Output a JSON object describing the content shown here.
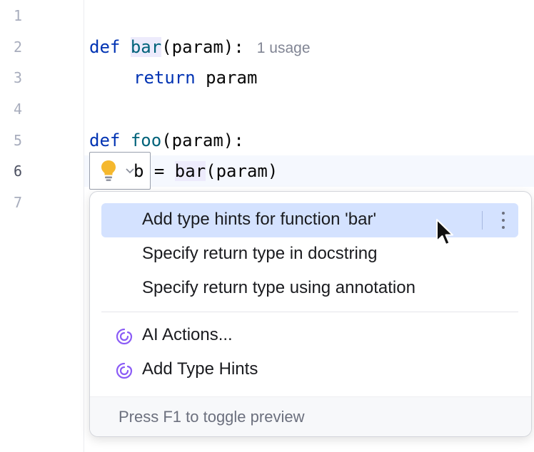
{
  "gutter": {
    "line_numbers": [
      "1",
      "2",
      "3",
      "4",
      "5",
      "6",
      "7"
    ],
    "current_line": "6"
  },
  "code": {
    "line2": {
      "kw": "def",
      "name": "bar",
      "rest": "(param):",
      "inlay_hint": "1 usage"
    },
    "line3": {
      "kw": "return",
      "rest": "param"
    },
    "line5": {
      "kw": "def",
      "name": "foo",
      "rest": "(param):"
    },
    "line6": {
      "lhs": "b = ",
      "call": "bar",
      "rest": "(param)"
    }
  },
  "intention_popup": {
    "items": [
      {
        "label": "Add type hints for function 'bar'",
        "selected": true
      },
      {
        "label": "Specify return type in docstring"
      },
      {
        "label": "Specify return type using annotation"
      }
    ],
    "ai_items": [
      {
        "label": "AI Actions...",
        "icon": "ai-spiral-icon"
      },
      {
        "label": "Add Type Hints",
        "icon": "ai-spiral-icon"
      }
    ],
    "footer": "Press F1 to toggle preview"
  },
  "colors": {
    "keyword": "#0033b3",
    "function": "#00627a",
    "selection": "#d4e2ff",
    "ai_icon": "#8b5cf6",
    "bulb": "#f5b82e"
  }
}
